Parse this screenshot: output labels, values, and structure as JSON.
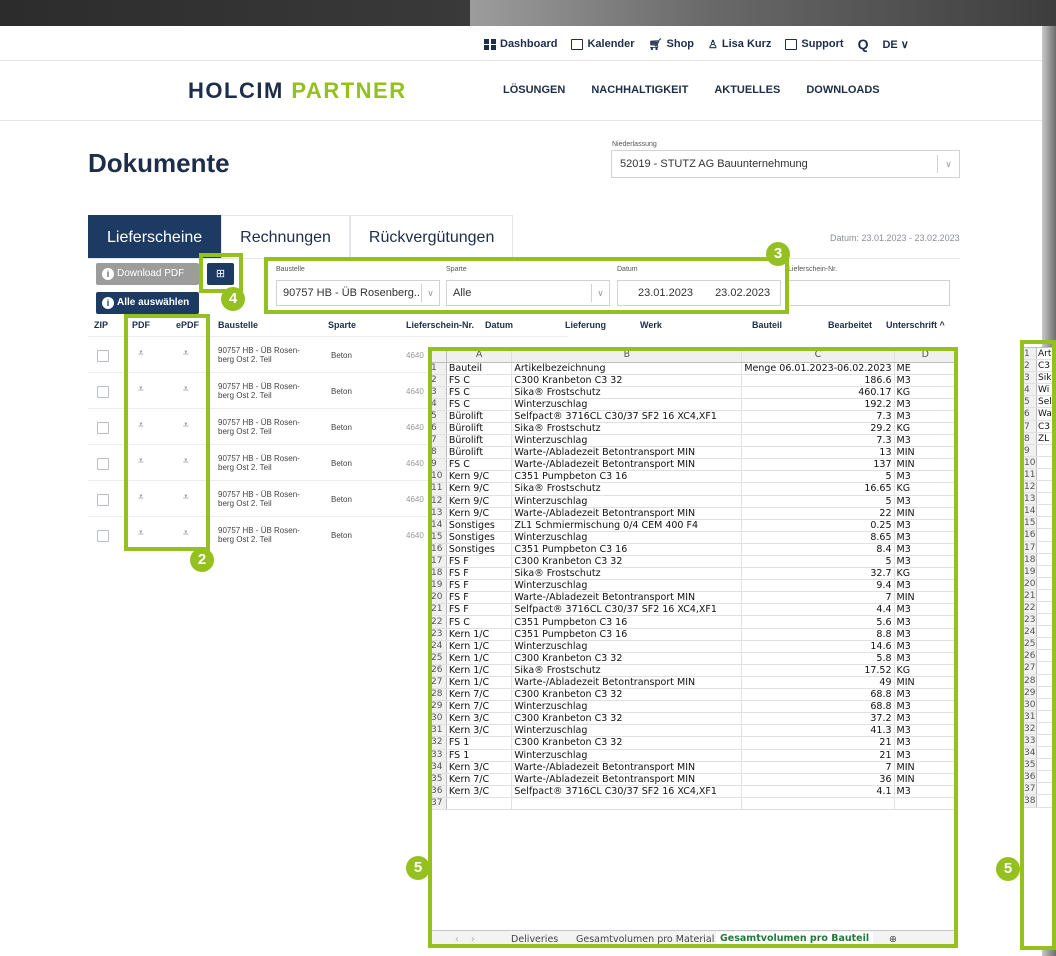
{
  "util_nav": [
    {
      "icon": "grid-icon",
      "label": "Dashboard"
    },
    {
      "icon": "calendar-icon",
      "label": "Kalender"
    },
    {
      "icon": "cart-icon",
      "label": "Shop"
    },
    {
      "icon": "user-icon",
      "label": "Lisa Kurz"
    },
    {
      "icon": "mail-icon",
      "label": "Support"
    },
    {
      "icon": "search-icon",
      "label": "Q"
    },
    {
      "icon": "chevron-down-icon",
      "label": "DE ∨"
    }
  ],
  "logo": {
    "holcim": "HOLCIM",
    "partner": "PARTNER"
  },
  "main_nav": [
    "LÖSUNGEN",
    "NACHHALTIGKEIT",
    "AKTUELLES",
    "DOWNLOADS"
  ],
  "page_title": "Dokumente",
  "niederlassung": {
    "label": "Niederlassung",
    "value": "52019 - STUTZ AG Bauunternehmung"
  },
  "tabs": [
    "Lieferscheine",
    "Rechnungen",
    "Rückvergütungen"
  ],
  "date_range": "Datum: 23.01.2023 - 23.02.2023",
  "buttons": {
    "download_pdf": "Download PDF",
    "select_all": "Alle auswählen",
    "columns": "⊞"
  },
  "filters": {
    "baustelle_label": "Baustelle",
    "baustelle_value": "90757 HB - ÜB Rosenberg...",
    "sparte_label": "Sparte",
    "sparte_value": "Alle",
    "datum_label": "Datum",
    "datum_from": "23.01.2023",
    "datum_to": "23.02.2023",
    "lieferschein_label": "Lieferschein-Nr.",
    "lieferschein_value": ""
  },
  "table_headers": [
    "ZIP",
    "PDF",
    "ePDF",
    "Baustelle",
    "Sparte",
    "Lieferschein-Nr.",
    "Datum",
    "Lieferung",
    "Werk",
    "Bauteil",
    "Bearbeitet",
    "Unterschrift ^"
  ],
  "rows": [
    {
      "baustelle": "90757 HB - ÜB Rosen-berg Ost 2. Teil",
      "sparte": "Beton",
      "nr": "4640"
    },
    {
      "baustelle": "90757 HB - ÜB Rosen-berg Ost 2. Teil",
      "sparte": "Beton",
      "nr": "4640"
    },
    {
      "baustelle": "90757 HB - ÜB Rosen-berg Ost 2. Teil",
      "sparte": "Beton",
      "nr": "4640"
    },
    {
      "baustelle": "90757 HB - ÜB Rosen-berg Ost 2. Teil",
      "sparte": "Beton",
      "nr": "4640"
    },
    {
      "baustelle": "90757 HB - ÜB Rosen-berg Ost 2. Teil",
      "sparte": "Beton",
      "nr": "4640"
    },
    {
      "baustelle": "90757 HB - ÜB Rosen-berg Ost 2. Teil",
      "sparte": "Beton",
      "nr": "4640"
    }
  ],
  "badges": [
    "2",
    "3",
    "4",
    "5",
    "5"
  ],
  "excel": {
    "columns": [
      "A",
      "B",
      "C",
      "D"
    ],
    "rows": [
      [
        "Bauteil",
        "Artikelbezeichnung",
        "Menge 06.01.2023-06.02.2023",
        "ME"
      ],
      [
        "FS C",
        "C300 Kranbeton C3 32",
        "186.6",
        "M3"
      ],
      [
        "FS C",
        "Sika® Frostschutz",
        "460.17",
        "KG"
      ],
      [
        "FS C",
        "Winterzuschlag",
        "192.2",
        "M3"
      ],
      [
        "Bürolift",
        "Selfpact® 3716CL C30/37 SF2 16 XC4,XF1",
        "7.3",
        "M3"
      ],
      [
        "Bürolift",
        "Sika® Frostschutz",
        "29.2",
        "KG"
      ],
      [
        "Bürolift",
        "Winterzuschlag",
        "7.3",
        "M3"
      ],
      [
        "Bürolift",
        "Warte-/Abladezeit Betontransport MIN",
        "13",
        "MIN"
      ],
      [
        "FS C",
        "Warte-/Abladezeit Betontransport MIN",
        "137",
        "MIN"
      ],
      [
        "Kern 9/C",
        "C351 Pumpbeton C3 16",
        "5",
        "M3"
      ],
      [
        "Kern 9/C",
        "Sika® Frostschutz",
        "16.65",
        "KG"
      ],
      [
        "Kern 9/C",
        "Winterzuschlag",
        "5",
        "M3"
      ],
      [
        "Kern 9/C",
        "Warte-/Abladezeit Betontransport MIN",
        "22",
        "MIN"
      ],
      [
        "Sonstiges",
        "ZL1 Schmiermischung 0/4 CEM 400 F4",
        "0.25",
        "M3"
      ],
      [
        "Sonstiges",
        "Winterzuschlag",
        "8.65",
        "M3"
      ],
      [
        "Sonstiges",
        "C351 Pumpbeton C3 16",
        "8.4",
        "M3"
      ],
      [
        "FS F",
        "C300 Kranbeton C3 32",
        "5",
        "M3"
      ],
      [
        "FS F",
        "Sika® Frostschutz",
        "32.7",
        "KG"
      ],
      [
        "FS F",
        "Winterzuschlag",
        "9.4",
        "M3"
      ],
      [
        "FS F",
        "Warte-/Abladezeit Betontransport MIN",
        "7",
        "MIN"
      ],
      [
        "FS F",
        "Selfpact® 3716CL C30/37 SF2 16 XC4,XF1",
        "4.4",
        "M3"
      ],
      [
        "FS C",
        "C351 Pumpbeton C3 16",
        "5.6",
        "M3"
      ],
      [
        "Kern 1/C",
        "C351 Pumpbeton C3 16",
        "8.8",
        "M3"
      ],
      [
        "Kern 1/C",
        "Winterzuschlag",
        "14.6",
        "M3"
      ],
      [
        "Kern 1/C",
        "C300 Kranbeton C3 32",
        "5.8",
        "M3"
      ],
      [
        "Kern 1/C",
        "Sika® Frostschutz",
        "17.52",
        "KG"
      ],
      [
        "Kern 1/C",
        "Warte-/Abladezeit Betontransport MIN",
        "49",
        "MIN"
      ],
      [
        "Kern 7/C",
        "C300 Kranbeton C3 32",
        "68.8",
        "M3"
      ],
      [
        "Kern 7/C",
        "Winterzuschlag",
        "68.8",
        "M3"
      ],
      [
        "Kern 3/C",
        "C300 Kranbeton C3 32",
        "37.2",
        "M3"
      ],
      [
        "Kern 3/C",
        "Winterzuschlag",
        "41.3",
        "M3"
      ],
      [
        "FS 1",
        "C300 Kranbeton C3 32",
        "21",
        "M3"
      ],
      [
        "FS 1",
        "Winterzuschlag",
        "21",
        "M3"
      ],
      [
        "Kern 3/C",
        "Warte-/Abladezeit Betontransport MIN",
        "7",
        "MIN"
      ],
      [
        "Kern 7/C",
        "Warte-/Abladezeit Betontransport MIN",
        "36",
        "MIN"
      ],
      [
        "Kern 3/C",
        "Selfpact® 3716CL C30/37 SF2 16 XC4,XF1",
        "4.1",
        "M3"
      ],
      [
        "",
        "",
        "",
        ""
      ]
    ],
    "sheet_tabs": [
      "Deliveries",
      "Gesamtvolumen pro Material",
      "Gesamtvolumen pro Bauteil"
    ],
    "active_sheet": "Gesamtvolumen pro Bauteil"
  },
  "excel2_rows": [
    "Art",
    "C3",
    "Sik",
    "Wi",
    "Sel",
    "Wa",
    "C3",
    "ZL",
    "",
    "",
    "",
    "",
    "",
    "",
    "",
    "",
    "",
    "",
    "",
    "",
    "",
    "",
    "",
    "",
    "",
    "",
    "",
    "",
    "",
    "",
    "",
    "",
    "",
    "",
    "",
    "",
    "",
    ""
  ]
}
